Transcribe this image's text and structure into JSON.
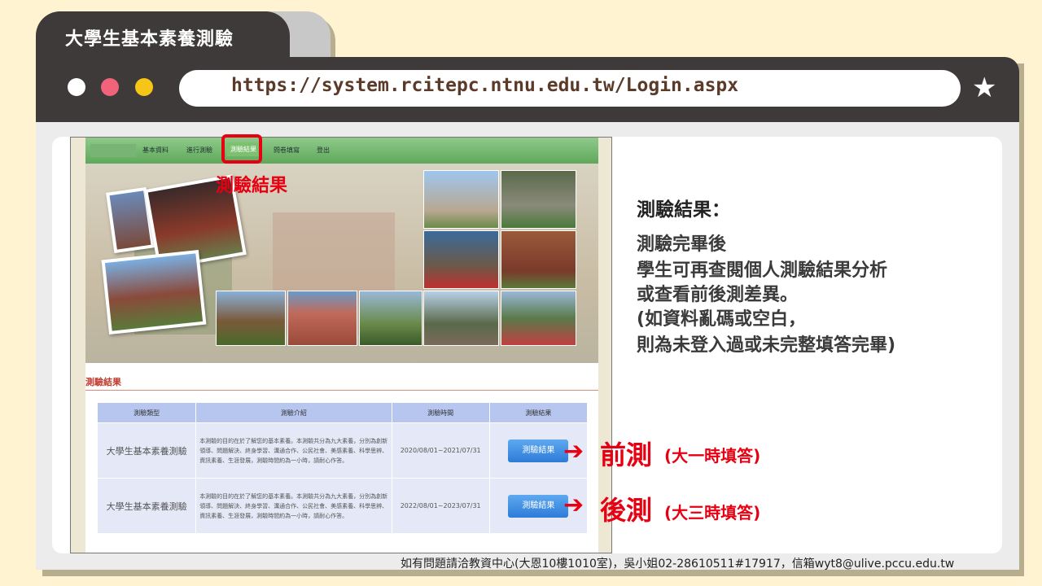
{
  "window": {
    "tab_title": "大學生基本素養測驗",
    "url": "https://system.rcitepc.ntnu.edu.tw/Login.aspx",
    "star_icon": "star-icon"
  },
  "site": {
    "nav": [
      "基本資料",
      "進行測驗",
      "測驗結果",
      "問卷填寫",
      "登出"
    ],
    "highlight_callout": "測驗結果",
    "section_title": "測驗結果",
    "table": {
      "headers": [
        "測驗類型",
        "測驗介紹",
        "測驗時間",
        "測驗結果"
      ],
      "rows": [
        {
          "type": "大學生基本素養測驗",
          "intro": "本測驗的目的在於了解您的基本素養。本測驗共分為九大素養，分別為創新領導、問題解決、終身學習、溝通合作、公民社會、美感素養、科學思辨、資訊素養、生涯發展，測驗時間約為一小時，請耐心作答。",
          "time": "2020/08/01~2021/07/31",
          "button": "測驗結果"
        },
        {
          "type": "大學生基本素養測驗",
          "intro": "本測驗的目的在於了解您的基本素養。本測驗共分為九大素養，分別為創新領導、問題解決、終身學習、溝通合作、公民社會、美感素養、科學思辨、資訊素養、生涯發展，測驗時間約為一小時，請耐心作答。",
          "time": "2022/08/01~2023/07/31",
          "button": "測驗結果"
        }
      ]
    }
  },
  "callouts": {
    "pre_big": "前測",
    "pre_small": "(大一時填答)",
    "post_big": "後測",
    "post_small": "(大三時填答)",
    "arrow": "➔"
  },
  "explain": {
    "title": "測驗結果：",
    "lines": [
      "測驗完畢後",
      "學生可再查閱個人測驗結果分析",
      "或查看前後測差異。",
      "(如資料亂碼或空白，",
      "則為未登入過或未完整填答完畢)"
    ]
  },
  "footer": "如有問題請洽教資中心(大恩10樓1010室)，吳小姐02-28610511#17917，信箱wyt8@ulive.pccu.edu.tw",
  "colors": {
    "accent_red": "#e60012",
    "frame_dark": "#3e3a39",
    "background": "#fff3d1"
  }
}
